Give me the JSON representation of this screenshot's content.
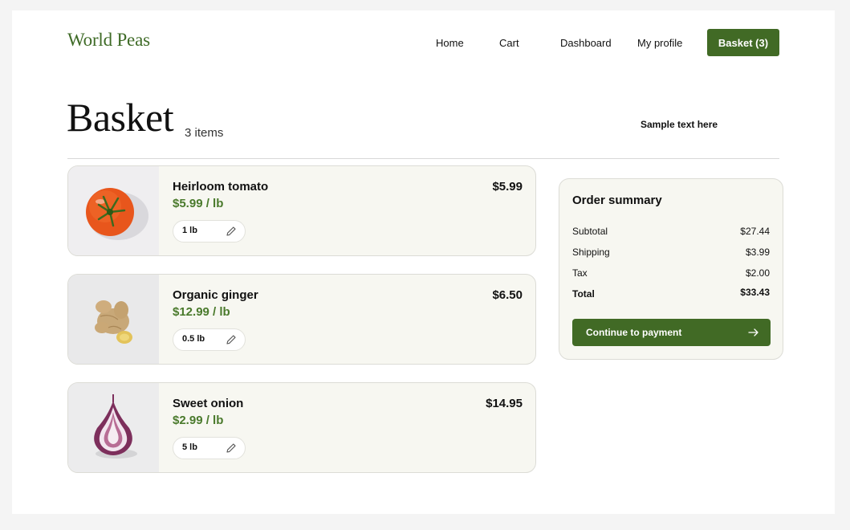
{
  "header": {
    "logo": "World Peas",
    "nav": [
      "Home",
      "Cart",
      "Dashboard",
      "My profile"
    ],
    "basket_button": "Basket (3)"
  },
  "page": {
    "title": "Basket",
    "item_count": "3 items",
    "sample_text": "Sample text here"
  },
  "items": [
    {
      "name": "Heirloom tomato",
      "unit_price": "$5.99 / lb",
      "quantity": "1 lb",
      "price": "$5.99",
      "image": "tomato"
    },
    {
      "name": "Organic ginger",
      "unit_price": "$12.99 / lb",
      "quantity": "0.5 lb",
      "price": "$6.50",
      "image": "ginger"
    },
    {
      "name": "Sweet onion",
      "unit_price": "$2.99 / lb",
      "quantity": "5 lb",
      "price": "$14.95",
      "image": "onion"
    }
  ],
  "summary": {
    "title": "Order summary",
    "rows": [
      {
        "label": "Subtotal",
        "value": "$27.44"
      },
      {
        "label": "Shipping",
        "value": "$3.99"
      },
      {
        "label": "Tax",
        "value": "$2.00"
      },
      {
        "label": "Total",
        "value": "$33.43"
      }
    ],
    "button": "Continue to payment",
    "button_icon": "arrow-right-icon"
  },
  "colors": {
    "brand_green": "#416a25",
    "price_green": "#4a7a2c",
    "card_bg": "#f7f7f1"
  }
}
